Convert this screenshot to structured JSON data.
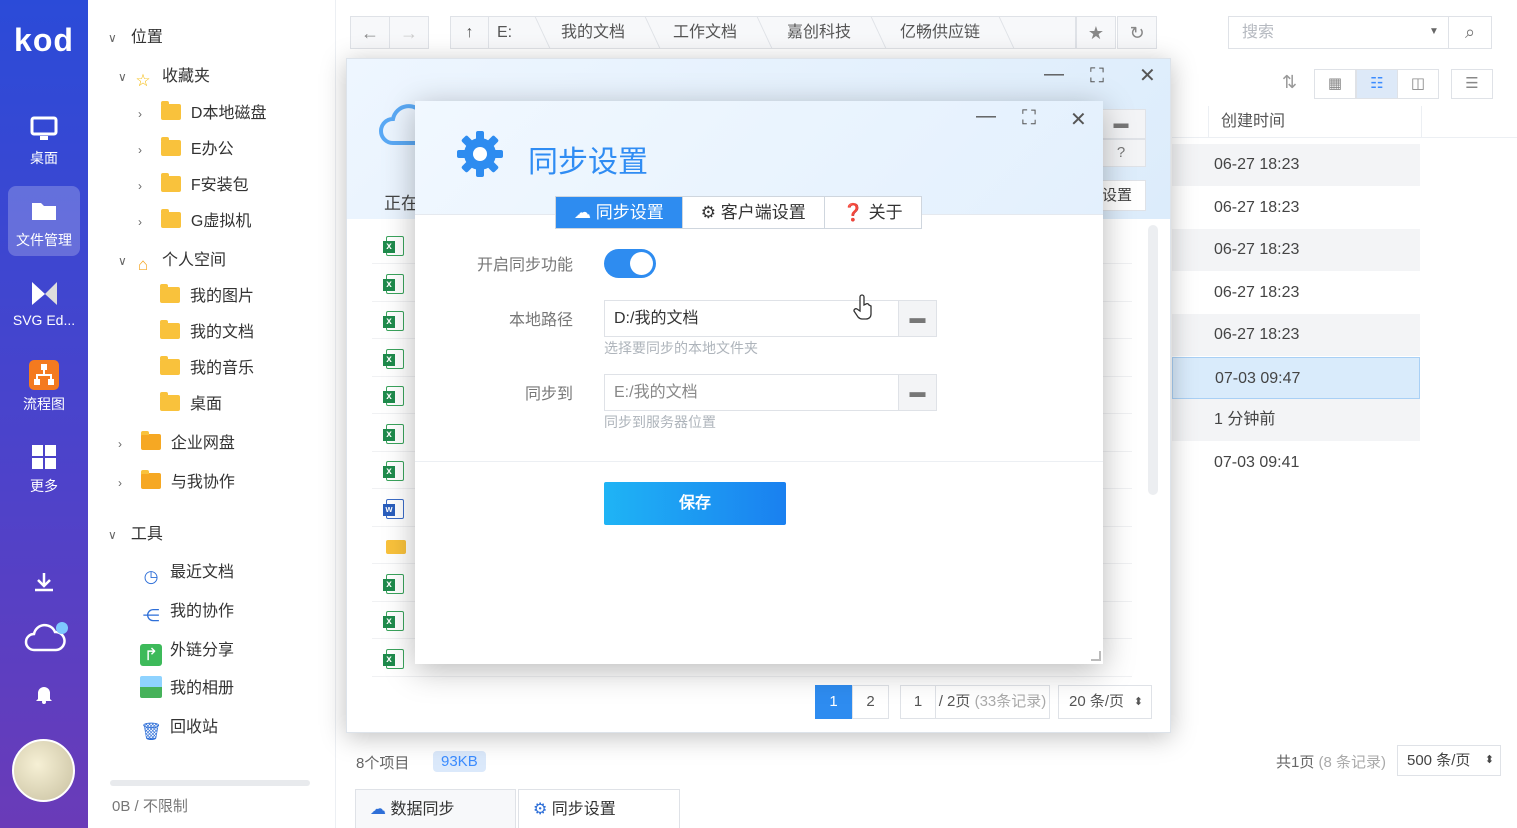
{
  "app": {
    "logo": "kod"
  },
  "rail": {
    "items": [
      {
        "label": "桌面"
      },
      {
        "label": "文件管理"
      },
      {
        "label": "SVG Ed..."
      },
      {
        "label": "流程图"
      },
      {
        "label": "更多"
      }
    ]
  },
  "tree": {
    "location": "位置",
    "favorites": "收藏夹",
    "fav_items": [
      "D本地磁盘",
      "E办公",
      "F安装包",
      "G虚拟机"
    ],
    "personal": "个人空间",
    "personal_items": [
      "我的图片",
      "我的文档",
      "我的音乐",
      "桌面"
    ],
    "enterprise": "企业网盘",
    "collab": "与我协作",
    "tools": "工具",
    "tool_items": [
      "最近文档",
      "我的协作",
      "外链分享",
      "我的相册",
      "回收站"
    ],
    "quota": "0B / 不限制"
  },
  "toolbar": {
    "crumbs": [
      "E:",
      "我的文档",
      "工作文档",
      "嘉创科技",
      "亿畅供应链"
    ],
    "search_placeholder": "搜索"
  },
  "list": {
    "col_created": "创建时间",
    "dates": [
      "06-27 18:23",
      "06-27 18:23",
      "06-27 18:23",
      "06-27 18:23",
      "06-27 18:23",
      "07-03 09:47",
      "1 分钟前",
      "07-03 09:41"
    ],
    "summary": "8个项目",
    "size": "93KB",
    "pages_total": "共1页",
    "records": "(8 条记录)",
    "per_page": "500 条/页"
  },
  "bottom_tabs": [
    "数据同步",
    "同步设置"
  ],
  "win1": {
    "status_prefix": "正在",
    "settings_btn": "设置",
    "page1": "1",
    "page2": "2",
    "page_input": "1",
    "page_of": "/ 2页",
    "page_records": "(33条记录)",
    "per_page": "20 条/页"
  },
  "win2": {
    "title": "同步设置",
    "tabs": [
      "同步设置",
      "客户端设置",
      "关于"
    ],
    "enable_label": "开启同步功能",
    "enable_value": true,
    "local_label": "本地路径",
    "local_value": "D:/我的文档",
    "local_hint": "选择要同步的本地文件夹",
    "sync_to_label": "同步到",
    "sync_to_value": "E:/我的文档",
    "sync_to_hint": "同步到服务器位置",
    "save": "保存"
  },
  "colors": {
    "accent": "#2e8cf0",
    "rail_top": "#2b4bd8",
    "rail_bottom": "#6a3bb8"
  }
}
